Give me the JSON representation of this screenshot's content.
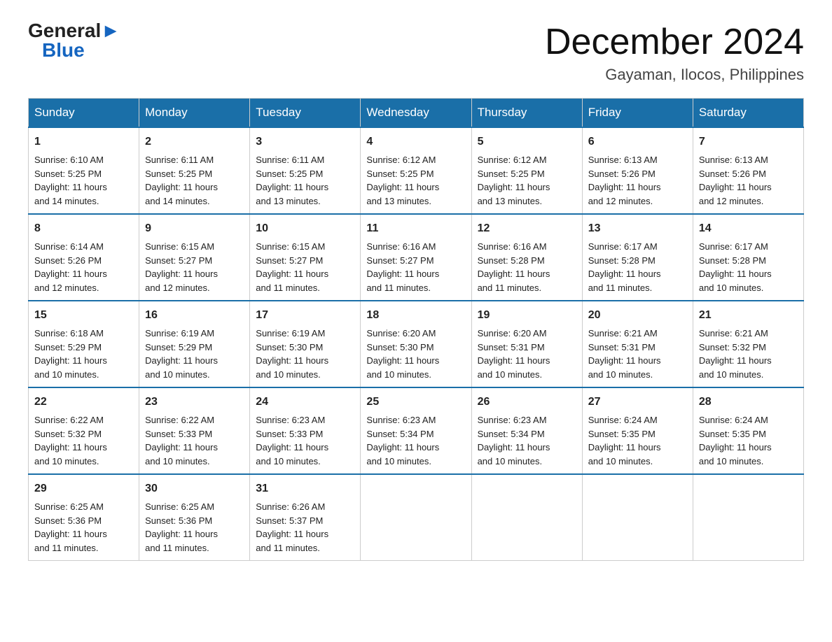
{
  "logo": {
    "general": "General",
    "blue": "Blue",
    "tagline": ""
  },
  "title": "December 2024",
  "subtitle": "Gayaman, Ilocos, Philippines",
  "headers": [
    "Sunday",
    "Monday",
    "Tuesday",
    "Wednesday",
    "Thursday",
    "Friday",
    "Saturday"
  ],
  "weeks": [
    [
      {
        "day": "1",
        "info": "Sunrise: 6:10 AM\nSunset: 5:25 PM\nDaylight: 11 hours\nand 14 minutes."
      },
      {
        "day": "2",
        "info": "Sunrise: 6:11 AM\nSunset: 5:25 PM\nDaylight: 11 hours\nand 14 minutes."
      },
      {
        "day": "3",
        "info": "Sunrise: 6:11 AM\nSunset: 5:25 PM\nDaylight: 11 hours\nand 13 minutes."
      },
      {
        "day": "4",
        "info": "Sunrise: 6:12 AM\nSunset: 5:25 PM\nDaylight: 11 hours\nand 13 minutes."
      },
      {
        "day": "5",
        "info": "Sunrise: 6:12 AM\nSunset: 5:25 PM\nDaylight: 11 hours\nand 13 minutes."
      },
      {
        "day": "6",
        "info": "Sunrise: 6:13 AM\nSunset: 5:26 PM\nDaylight: 11 hours\nand 12 minutes."
      },
      {
        "day": "7",
        "info": "Sunrise: 6:13 AM\nSunset: 5:26 PM\nDaylight: 11 hours\nand 12 minutes."
      }
    ],
    [
      {
        "day": "8",
        "info": "Sunrise: 6:14 AM\nSunset: 5:26 PM\nDaylight: 11 hours\nand 12 minutes."
      },
      {
        "day": "9",
        "info": "Sunrise: 6:15 AM\nSunset: 5:27 PM\nDaylight: 11 hours\nand 12 minutes."
      },
      {
        "day": "10",
        "info": "Sunrise: 6:15 AM\nSunset: 5:27 PM\nDaylight: 11 hours\nand 11 minutes."
      },
      {
        "day": "11",
        "info": "Sunrise: 6:16 AM\nSunset: 5:27 PM\nDaylight: 11 hours\nand 11 minutes."
      },
      {
        "day": "12",
        "info": "Sunrise: 6:16 AM\nSunset: 5:28 PM\nDaylight: 11 hours\nand 11 minutes."
      },
      {
        "day": "13",
        "info": "Sunrise: 6:17 AM\nSunset: 5:28 PM\nDaylight: 11 hours\nand 11 minutes."
      },
      {
        "day": "14",
        "info": "Sunrise: 6:17 AM\nSunset: 5:28 PM\nDaylight: 11 hours\nand 10 minutes."
      }
    ],
    [
      {
        "day": "15",
        "info": "Sunrise: 6:18 AM\nSunset: 5:29 PM\nDaylight: 11 hours\nand 10 minutes."
      },
      {
        "day": "16",
        "info": "Sunrise: 6:19 AM\nSunset: 5:29 PM\nDaylight: 11 hours\nand 10 minutes."
      },
      {
        "day": "17",
        "info": "Sunrise: 6:19 AM\nSunset: 5:30 PM\nDaylight: 11 hours\nand 10 minutes."
      },
      {
        "day": "18",
        "info": "Sunrise: 6:20 AM\nSunset: 5:30 PM\nDaylight: 11 hours\nand 10 minutes."
      },
      {
        "day": "19",
        "info": "Sunrise: 6:20 AM\nSunset: 5:31 PM\nDaylight: 11 hours\nand 10 minutes."
      },
      {
        "day": "20",
        "info": "Sunrise: 6:21 AM\nSunset: 5:31 PM\nDaylight: 11 hours\nand 10 minutes."
      },
      {
        "day": "21",
        "info": "Sunrise: 6:21 AM\nSunset: 5:32 PM\nDaylight: 11 hours\nand 10 minutes."
      }
    ],
    [
      {
        "day": "22",
        "info": "Sunrise: 6:22 AM\nSunset: 5:32 PM\nDaylight: 11 hours\nand 10 minutes."
      },
      {
        "day": "23",
        "info": "Sunrise: 6:22 AM\nSunset: 5:33 PM\nDaylight: 11 hours\nand 10 minutes."
      },
      {
        "day": "24",
        "info": "Sunrise: 6:23 AM\nSunset: 5:33 PM\nDaylight: 11 hours\nand 10 minutes."
      },
      {
        "day": "25",
        "info": "Sunrise: 6:23 AM\nSunset: 5:34 PM\nDaylight: 11 hours\nand 10 minutes."
      },
      {
        "day": "26",
        "info": "Sunrise: 6:23 AM\nSunset: 5:34 PM\nDaylight: 11 hours\nand 10 minutes."
      },
      {
        "day": "27",
        "info": "Sunrise: 6:24 AM\nSunset: 5:35 PM\nDaylight: 11 hours\nand 10 minutes."
      },
      {
        "day": "28",
        "info": "Sunrise: 6:24 AM\nSunset: 5:35 PM\nDaylight: 11 hours\nand 10 minutes."
      }
    ],
    [
      {
        "day": "29",
        "info": "Sunrise: 6:25 AM\nSunset: 5:36 PM\nDaylight: 11 hours\nand 11 minutes."
      },
      {
        "day": "30",
        "info": "Sunrise: 6:25 AM\nSunset: 5:36 PM\nDaylight: 11 hours\nand 11 minutes."
      },
      {
        "day": "31",
        "info": "Sunrise: 6:26 AM\nSunset: 5:37 PM\nDaylight: 11 hours\nand 11 minutes."
      },
      {
        "day": "",
        "info": ""
      },
      {
        "day": "",
        "info": ""
      },
      {
        "day": "",
        "info": ""
      },
      {
        "day": "",
        "info": ""
      }
    ]
  ]
}
